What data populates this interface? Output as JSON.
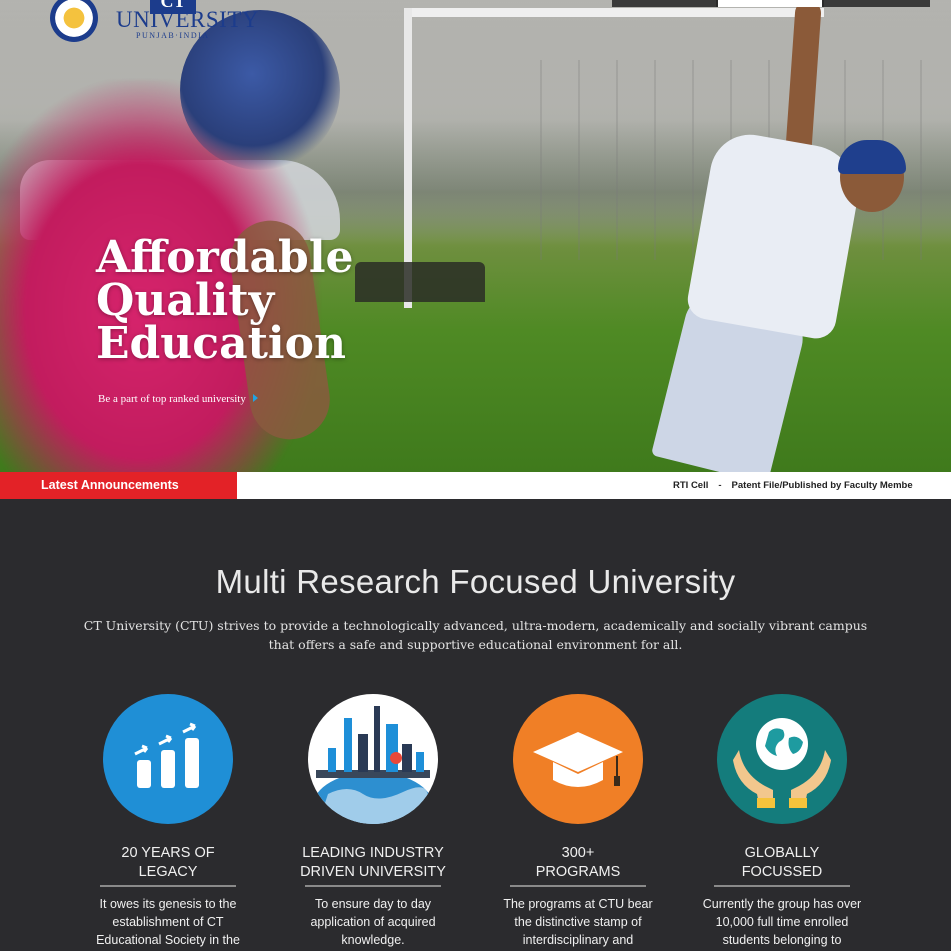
{
  "header": {
    "logo": {
      "ct_mark": "CT",
      "name": "UNIVERSITY",
      "location": "PUNJAB·INDIA",
      "emblem_text": "CT PUNJAB INDIA"
    }
  },
  "hero": {
    "title_lines": [
      "Affordable",
      "Quality",
      "Education"
    ],
    "cta_text": "Be a part of top ranked university",
    "cta_icon": "caret-right-icon"
  },
  "ticker": {
    "label": "Latest Announcements",
    "items": [
      "RTI Cell",
      "Patent File/Published by Faculty Membe"
    ],
    "separator": "-"
  },
  "main": {
    "title": "Multi Research Focused University",
    "description": "CT University (CTU) strives to provide a technologically advanced, ultra-modern, academically and socially vibrant campus that offers a safe and supportive educational environment for all.",
    "features": [
      {
        "icon": "growth-chart-icon",
        "color": "#1f8fd6",
        "title": "20 YEARS OF LEGACY",
        "title_lines": [
          "20 YEARS OF",
          "LEGACY"
        ],
        "text_lines": [
          "It owes its genesis to the",
          "establishment of CT",
          "Educational Society in the"
        ]
      },
      {
        "icon": "industry-icon",
        "color": "#ffffff",
        "title_lines": [
          "LEADING INDUSTRY",
          "DRIVEN UNIVERSITY"
        ],
        "text_lines": [
          "To ensure day to day",
          "application of acquired",
          "knowledge."
        ]
      },
      {
        "icon": "graduation-cap-icon",
        "color": "#f07f26",
        "title_lines": [
          "300+",
          "PROGRAMS"
        ],
        "text_lines": [
          "The programs at CTU bear",
          "the distinctive stamp of",
          "interdisciplinary and"
        ]
      },
      {
        "icon": "globe-hands-icon",
        "color": "#147c7c",
        "title_lines": [
          "GLOBALLY",
          "FOCUSSED"
        ],
        "text_lines": [
          "Currently the group has over",
          "10,000 full time enrolled",
          "students belonging to"
        ]
      }
    ]
  },
  "colors": {
    "accent_red": "#e32227",
    "background_dark": "#2b2b2e",
    "link_blue": "#21a3e2"
  }
}
